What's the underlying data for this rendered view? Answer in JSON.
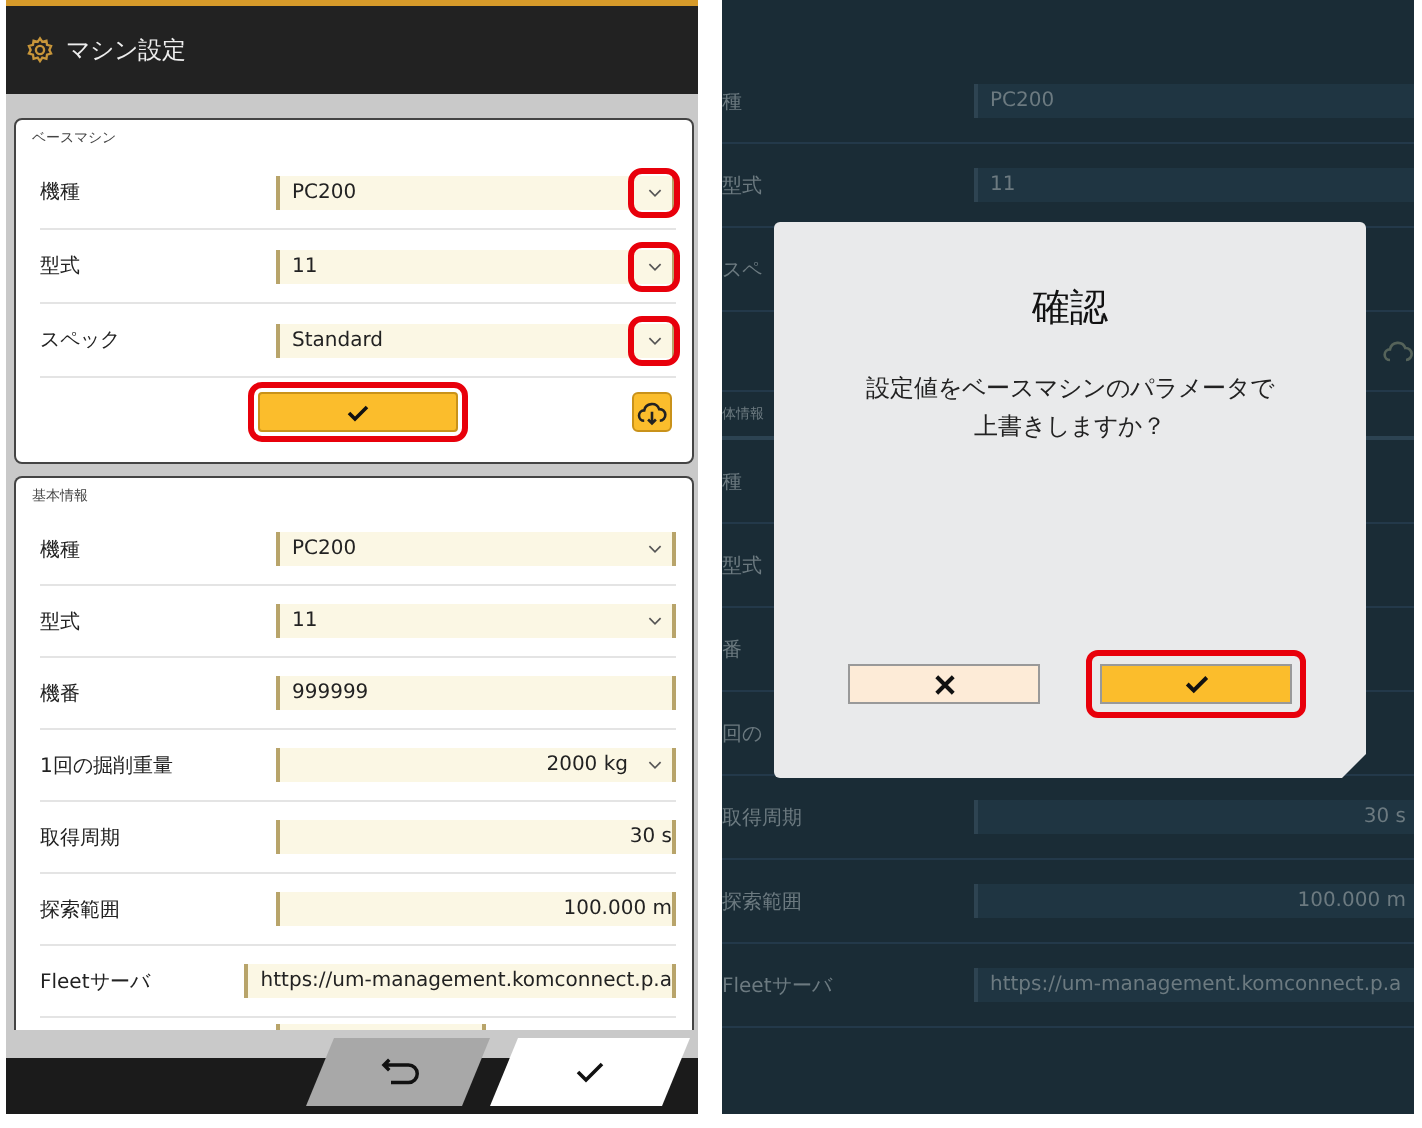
{
  "left_screen": {
    "title": "マシン設定",
    "base_machine": {
      "heading": "ベースマシン",
      "apply_highlighted": true,
      "fields": [
        {
          "label": "機種",
          "value": "PC200",
          "kind": "select",
          "highlighted": true
        },
        {
          "label": "型式",
          "value": "11",
          "kind": "select",
          "highlighted": true
        },
        {
          "label": "スペック",
          "value": "Standard",
          "kind": "select",
          "highlighted": true
        }
      ]
    },
    "basic_info": {
      "heading": "基本情報",
      "fields": [
        {
          "label": "機種",
          "value": "PC200",
          "kind": "select"
        },
        {
          "label": "型式",
          "value": "11",
          "kind": "select"
        },
        {
          "label": "機番",
          "value": "999999",
          "kind": "text"
        },
        {
          "label": "1回の掘削重量",
          "value": "2000 kg",
          "kind": "number_select"
        },
        {
          "label": "取得周期",
          "value": "30 s",
          "kind": "number"
        },
        {
          "label": "探索範囲",
          "value": "100.000 m",
          "kind": "number"
        },
        {
          "label": "Fleetサーバ",
          "value": "https://um-management.komconnect.p.a",
          "kind": "text"
        }
      ]
    }
  },
  "right_screen": {
    "background_rows": [
      {
        "label": "種",
        "value": "PC200"
      },
      {
        "label": "型式",
        "value": "11"
      },
      {
        "label": "スペ"
      },
      {
        "kind": "cloud"
      },
      {
        "kind": "heading",
        "label": "体情報"
      },
      {
        "label": "種"
      },
      {
        "label": "型式"
      },
      {
        "label": "番"
      },
      {
        "label": "回の"
      },
      {
        "label": "取得周期",
        "value": "30 s",
        "kind": "number"
      },
      {
        "label": "探索範囲",
        "value": "100.000 m",
        "kind": "number"
      },
      {
        "label": "Fleetサーバ",
        "value": "https://um-management.komconnect.p.a"
      }
    ],
    "dialog": {
      "title": "確認",
      "message_lines": [
        "設定値をベースマシンのパラメータで",
        "上書きしますか？"
      ],
      "buttons": [
        {
          "kind": "cancel",
          "highlighted": false
        },
        {
          "kind": "confirm",
          "highlighted": true
        }
      ]
    }
  }
}
